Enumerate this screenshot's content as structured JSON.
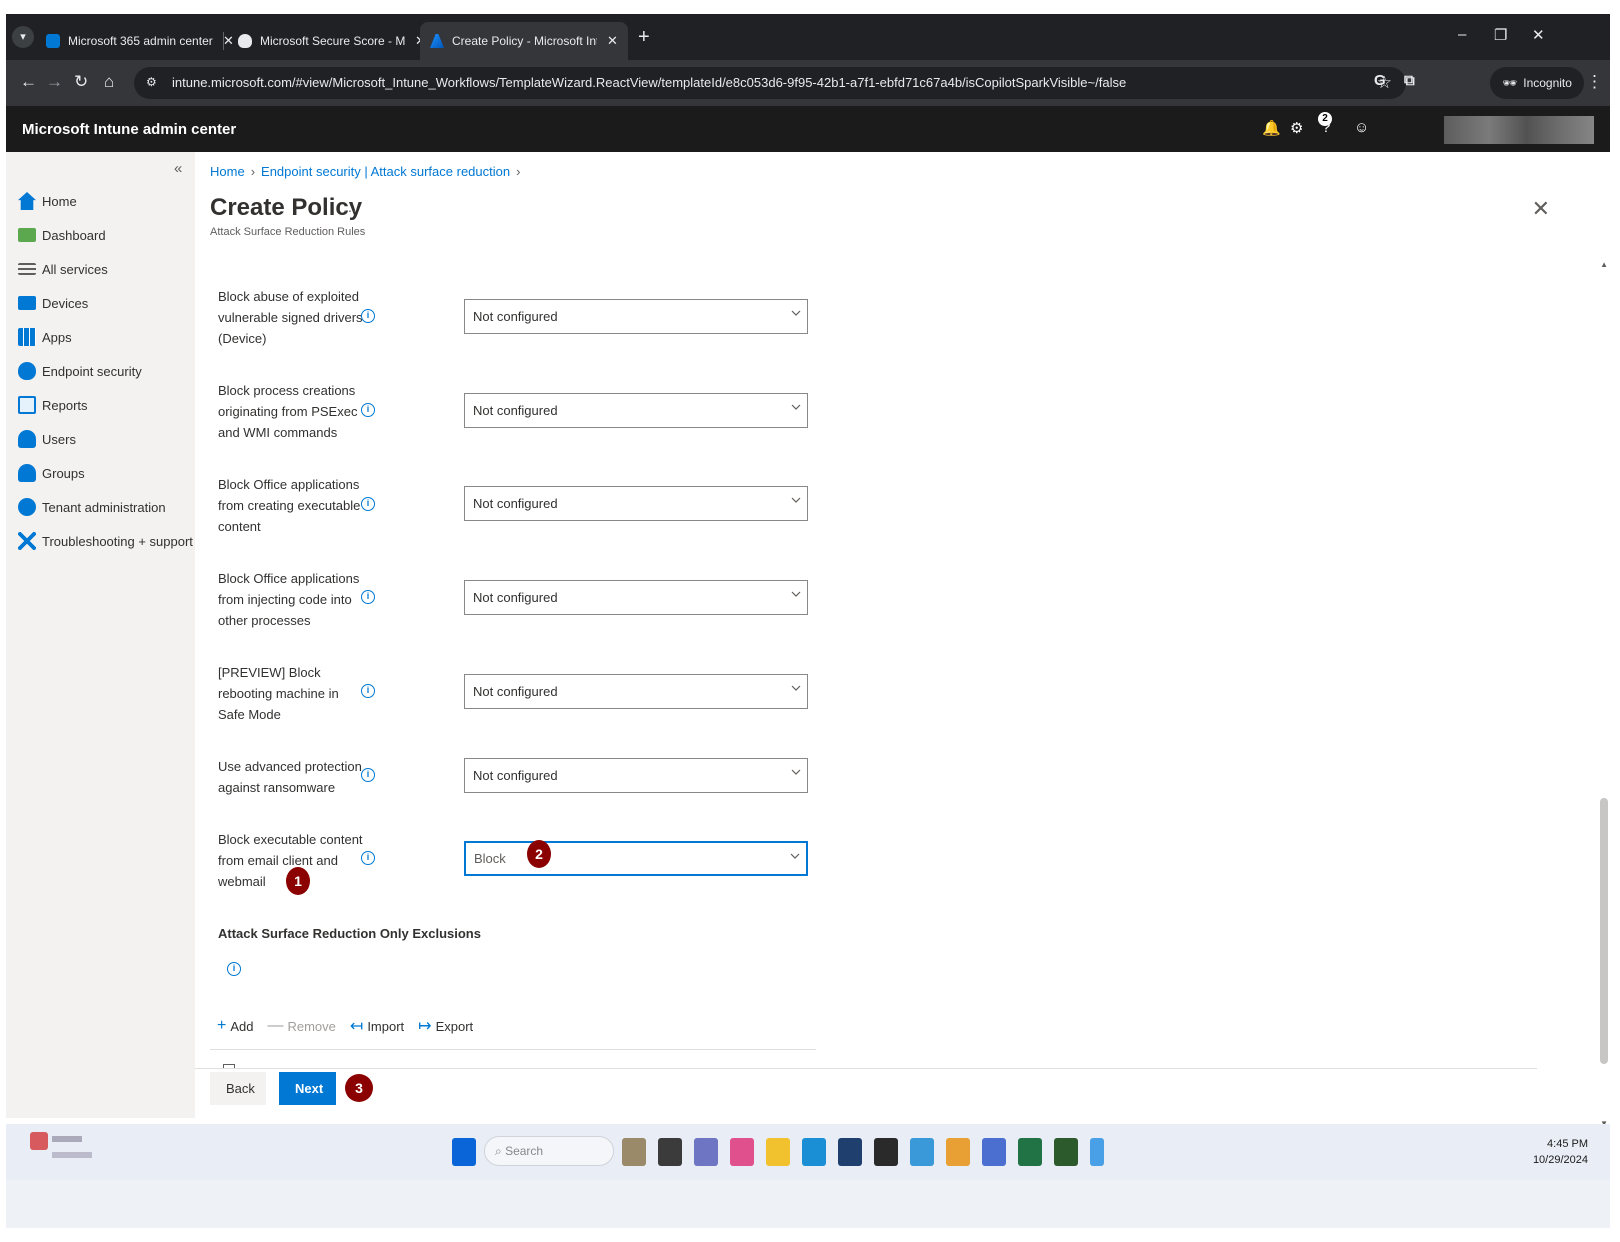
{
  "browser": {
    "tabs": [
      {
        "title": "Microsoft 365 admin center",
        "active": false
      },
      {
        "title": "Microsoft Secure Score - Micro",
        "active": false
      },
      {
        "title": "Create Policy - Microsoft Intune",
        "active": true
      }
    ],
    "url": "intune.microsoft.com/#view/Microsoft_Intune_Workflows/TemplateWizard.ReactView/templateId/e8c053d6-9f95-42b1-a7f1-ebfd71c67a4b/isCopilotSparkVisible~/false",
    "incognito_label": "Incognito"
  },
  "header": {
    "app_title": "Microsoft Intune admin center",
    "notification_count": "2"
  },
  "sidebar": {
    "items": [
      {
        "label": "Home",
        "icon": "home-icon",
        "color": "#0078d4"
      },
      {
        "label": "Dashboard",
        "icon": "dashboard-icon",
        "color": "#5ba84f"
      },
      {
        "label": "All services",
        "icon": "list-icon",
        "color": "#605e5c"
      },
      {
        "label": "Devices",
        "icon": "devices-icon",
        "color": "#0078d4"
      },
      {
        "label": "Apps",
        "icon": "apps-icon",
        "color": "#0078d4"
      },
      {
        "label": "Endpoint security",
        "icon": "shield-icon",
        "color": "#0078d4"
      },
      {
        "label": "Reports",
        "icon": "reports-icon",
        "color": "#0078d4"
      },
      {
        "label": "Users",
        "icon": "user-icon",
        "color": "#0078d4"
      },
      {
        "label": "Groups",
        "icon": "groups-icon",
        "color": "#0078d4"
      },
      {
        "label": "Tenant administration",
        "icon": "tenant-icon",
        "color": "#0078d4"
      },
      {
        "label": "Troubleshooting + support",
        "icon": "tools-icon",
        "color": "#0078d4"
      }
    ]
  },
  "main": {
    "breadcrumb": [
      "Home",
      "Endpoint security | Attack surface reduction"
    ],
    "title": "Create Policy",
    "subtitle": "Attack Surface Reduction Rules",
    "settings": [
      {
        "label": "Block abuse of exploited vulnerable signed drivers (Device)",
        "value": "Not configured"
      },
      {
        "label": "Block process creations originating from PSExec and WMI commands",
        "value": "Not configured"
      },
      {
        "label": "Block Office applications from creating executable content",
        "value": "Not configured"
      },
      {
        "label": "Block Office applications from injecting code into other processes",
        "value": "Not configured"
      },
      {
        "label": "[PREVIEW] Block rebooting machine in Safe Mode",
        "value": "Not configured"
      },
      {
        "label": "Use advanced protection against ransomware",
        "value": "Not configured"
      },
      {
        "label": "Block executable content from email client and webmail",
        "value": "Block"
      }
    ],
    "exclusions_label": "Attack Surface Reduction Only Exclusions",
    "toolbar": {
      "add": "Add",
      "remove": "Remove",
      "import": "Import",
      "export": "Export"
    },
    "back_label": "Back",
    "next_label": "Next"
  },
  "annotations": [
    "1",
    "2",
    "3"
  ],
  "taskbar": {
    "search_placeholder": "Search",
    "time": "4:45 PM",
    "date": "10/29/2024"
  },
  "colors": {
    "accent": "#0078d4",
    "annotation": "#8b0000"
  }
}
